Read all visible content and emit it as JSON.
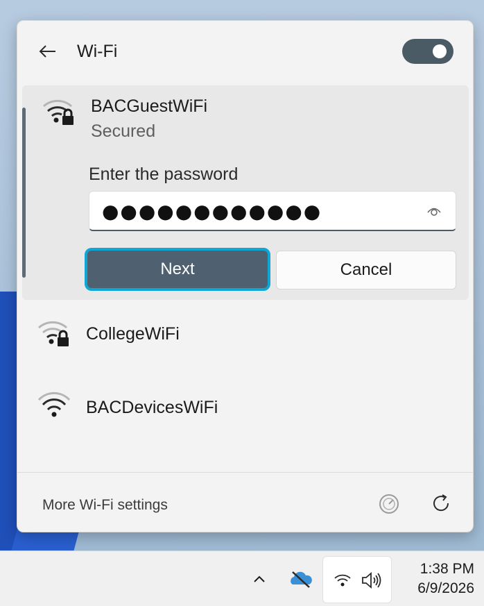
{
  "wifi_panel": {
    "title": "Wi-Fi",
    "toggle_on": true,
    "networks": [
      {
        "name": "BACGuestWiFi",
        "status": "Secured",
        "secured": true,
        "expanded": true,
        "password_label": "Enter the password",
        "password_value": "●●●●●●●●●●●●",
        "next_label": "Next",
        "cancel_label": "Cancel"
      },
      {
        "name": "CollegeWiFi",
        "secured": true
      },
      {
        "name": "BACDevicesWiFi",
        "secured": false
      }
    ],
    "footer_link": "More Wi-Fi settings"
  },
  "taskbar": {
    "time": "1:38 PM",
    "date": "6/9/2026"
  },
  "colors": {
    "accent_button": "#4f6170",
    "focus_ring": "#0fa6d4",
    "toggle_on": "#4b5b66"
  }
}
